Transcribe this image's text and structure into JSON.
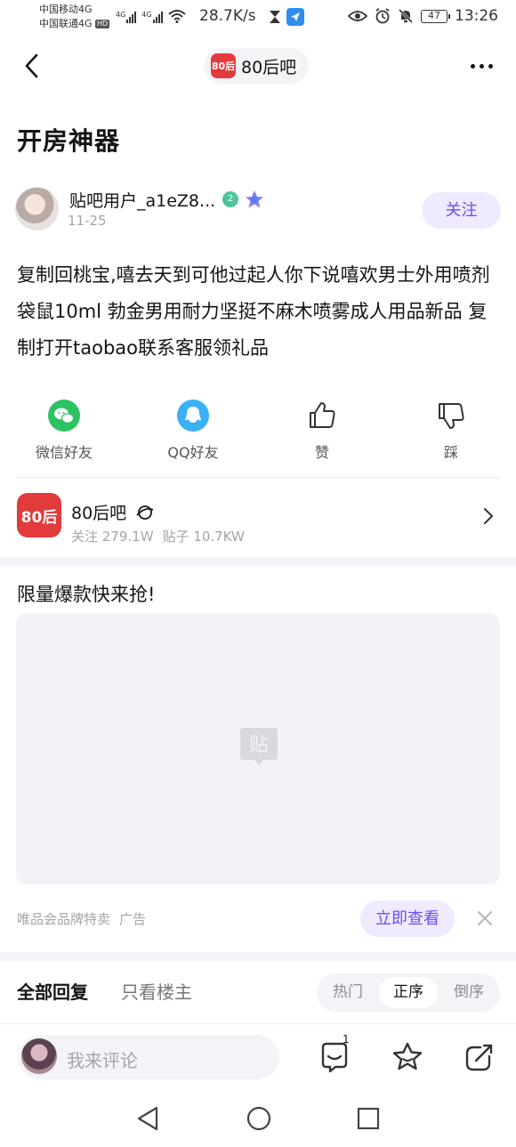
{
  "status_bar": {
    "carrier1": "中国移动4G",
    "carrier2": "中国联通4G",
    "hd": "HD",
    "net1": "4G",
    "net2": "4G",
    "speed": "28.7K/s",
    "battery": "47",
    "time": "13:26"
  },
  "nav": {
    "forum_logo_text": "80后",
    "forum_name": "80后吧"
  },
  "post": {
    "title": "开房神器",
    "author_name": "贴吧用户_a1eZ8...",
    "level": "2",
    "date": "11-25",
    "follow_label": "关注",
    "body": "复制回桃宝,嘻去天到可他过起人你下说嘻欢男士外用喷剂袋鼠10ml 勃金男用耐力坚挺不麻木喷雾成人用品新品 复制打开taobao联系客服领礼品"
  },
  "actions": [
    {
      "label": "微信好友",
      "icon": "wechat-icon"
    },
    {
      "label": "QQ好友",
      "icon": "qq-icon"
    },
    {
      "label": "赞",
      "icon": "thumbs-up-icon"
    },
    {
      "label": "踩",
      "icon": "thumbs-down-icon"
    }
  ],
  "forum_card": {
    "logo_text": "80后",
    "name": "80后吧",
    "followers": "关注 279.1W",
    "posts": "贴子 10.7KW"
  },
  "ad": {
    "title": "限量爆款快来抢!",
    "placeholder_text": "贴",
    "source": "唯品会品牌特卖",
    "tag": "广告",
    "cta": "立即查看"
  },
  "replies": {
    "tab_all": "全部回复",
    "tab_op": "只看楼主",
    "sort_options": [
      "热门",
      "正序",
      "倒序"
    ],
    "active_sort": "正序"
  },
  "bottom_bar": {
    "placeholder": "我来评论",
    "reply_count": "1"
  },
  "colors": {
    "accent": "#6e4df0",
    "accent_bg": "#efeaff",
    "forum_red": "#e23b3b",
    "wechat_green": "#2bc25f",
    "qq_blue": "#3ab0f7"
  }
}
